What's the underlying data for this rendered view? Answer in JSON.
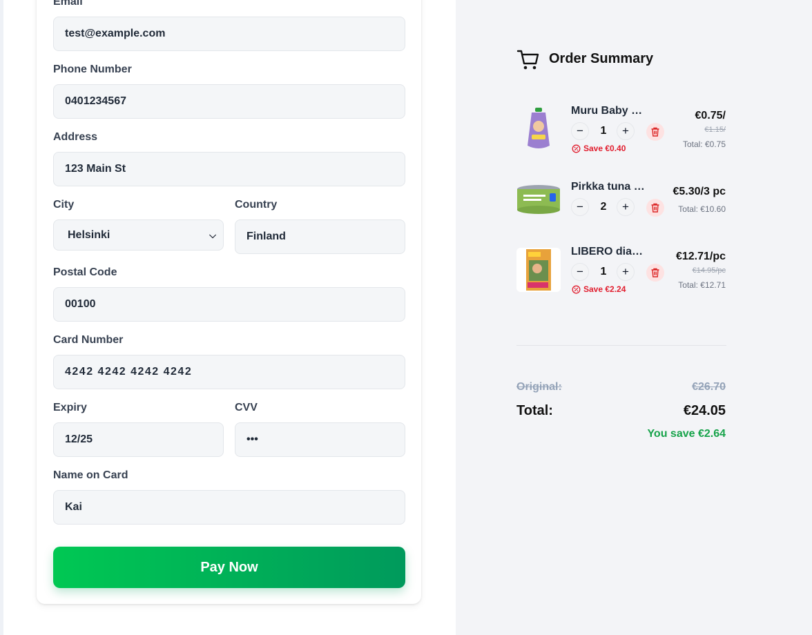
{
  "form": {
    "email": {
      "label": "Email",
      "value": "test@example.com"
    },
    "phone": {
      "label": "Phone Number",
      "value": "0401234567"
    },
    "address": {
      "label": "Address",
      "value": "123 Main St"
    },
    "city": {
      "label": "City",
      "value": "Helsinki"
    },
    "country": {
      "label": "Country",
      "value": "Finland"
    },
    "postal": {
      "label": "Postal Code",
      "value": "00100"
    },
    "card_number": {
      "label": "Card Number",
      "value": "4242 4242 4242 4242"
    },
    "expiry": {
      "label": "Expiry",
      "value": "12/25"
    },
    "cvv": {
      "label": "CVV",
      "value": "•••"
    },
    "name_on_card": {
      "label": "Name on Card",
      "value": "Kai"
    },
    "pay_label": "Pay Now"
  },
  "summary": {
    "title": "Order Summary",
    "items": [
      {
        "name": "Muru Baby fruit purée pouch",
        "qty": "1",
        "save": "Save €0.40",
        "price": "€0.75/",
        "old_price": "€1.15/",
        "total": "Total: €0.75"
      },
      {
        "name": "Pirkka tuna in olive oil",
        "qty": "2",
        "save": "",
        "price": "€5.30/3 pc",
        "old_price": "",
        "total": "Total: €10.60"
      },
      {
        "name": "LIBERO diapers Mega Pack",
        "qty": "1",
        "save": "Save €2.24",
        "price": "€12.71/pc",
        "old_price": "€14.95/pc",
        "total": "Total: €12.71"
      }
    ],
    "original_label": "Original:",
    "original_value": "€26.70",
    "total_label": "Total:",
    "total_value": "€24.05",
    "savings": "You save €2.64"
  },
  "colors": {
    "accent_start": "#00c853",
    "accent_end": "#009a5c",
    "danger": "#e11d2e",
    "savings_green": "#16a34a",
    "field_bg": "#f4f6f8",
    "summary_bg": "#f3f4f7"
  }
}
